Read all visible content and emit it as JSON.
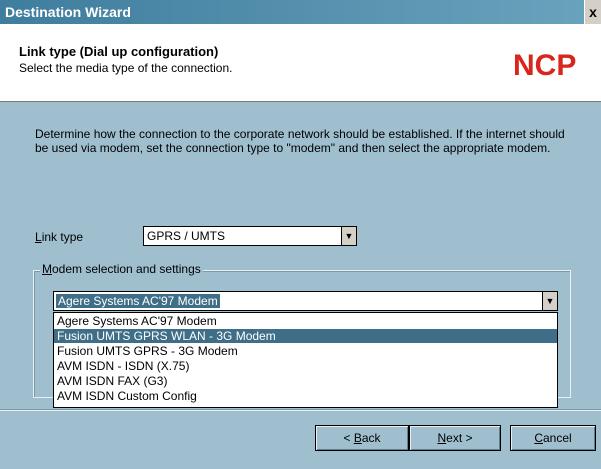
{
  "window": {
    "title": "Destination Wizard",
    "close_label": "x"
  },
  "header": {
    "title": "Link type (Dial up configuration)",
    "subtitle": "Select the media type of the connection.",
    "logo_text": "NCP",
    "logo_color": "#d9261c"
  },
  "description": "Determine how the connection to the corporate network should be established. If the internet should be used via modem, set the connection type to \"modem\" and then select the appropriate modem.",
  "link_type": {
    "label_first": "L",
    "label_rest": "ink type",
    "value": "GPRS / UMTS"
  },
  "modem_group": {
    "label_first": "M",
    "label_rest": "odem selection and settings",
    "selected": "Agere Systems AC'97 Modem",
    "options": [
      "Agere Systems AC'97 Modem",
      "Fusion UMTS GPRS WLAN - 3G Modem",
      "Fusion UMTS GPRS - 3G Modem",
      "AVM ISDN - ISDN (X.75)",
      "AVM ISDN FAX (G3)",
      "AVM ISDN Custom Config"
    ],
    "highlighted_index": 1
  },
  "buttons": {
    "back": {
      "prefix": "< ",
      "hotkey": "B",
      "rest": "ack"
    },
    "next": {
      "hotkey": "N",
      "rest": "ext >"
    },
    "cancel": {
      "hotkey": "C",
      "rest": "ancel"
    }
  }
}
